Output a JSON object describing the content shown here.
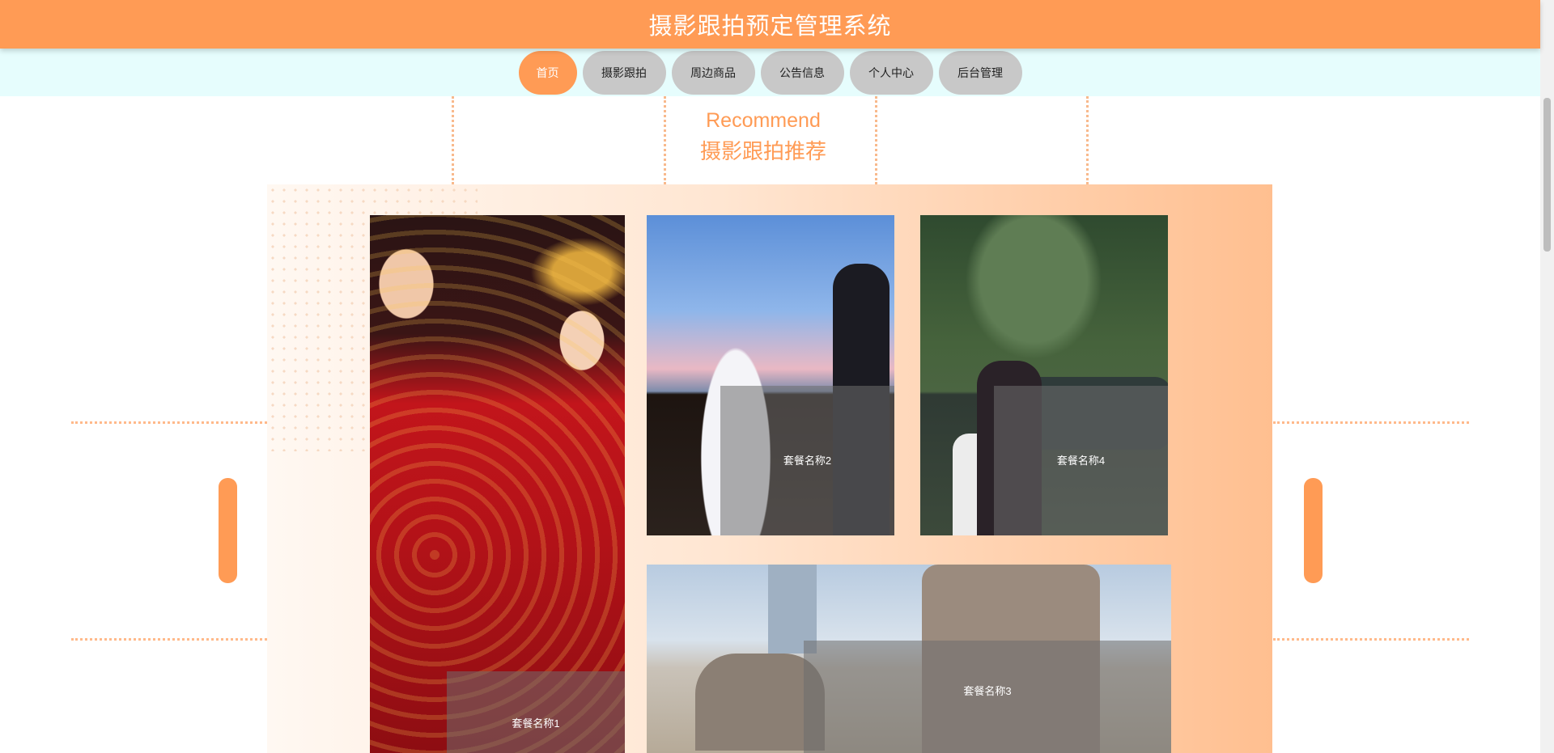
{
  "header": {
    "title": "摄影跟拍预定管理系统"
  },
  "nav": {
    "items": [
      {
        "label": "首页",
        "active": true
      },
      {
        "label": "摄影跟拍",
        "active": false
      },
      {
        "label": "周边商品",
        "active": false
      },
      {
        "label": "公告信息",
        "active": false
      },
      {
        "label": "个人中心",
        "active": false
      },
      {
        "label": "后台管理",
        "active": false
      }
    ]
  },
  "section": {
    "title_en": "Recommend",
    "title_cn": "摄影跟拍推荐"
  },
  "packages": [
    {
      "name": "套餐名称1"
    },
    {
      "name": "套餐名称2"
    },
    {
      "name": "套餐名称3"
    },
    {
      "name": "套餐名称4"
    }
  ],
  "colors": {
    "accent": "#ff9b55",
    "nav_bg": "#e6fdfd",
    "nav_inactive": "#c8c8c8"
  }
}
